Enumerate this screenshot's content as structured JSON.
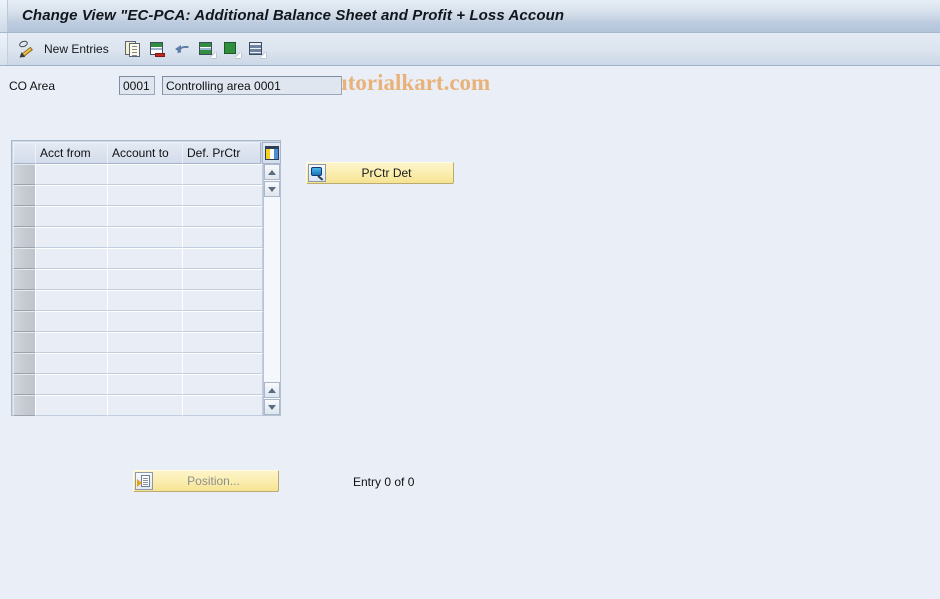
{
  "window": {
    "title": "Change View \"EC-PCA: Additional Balance Sheet and Profit + Loss Accoun"
  },
  "watermark": {
    "text": "www.tutorialkart.com",
    "color": "#e8b27a"
  },
  "toolbar": {
    "pencil_icon": "pencil-icon",
    "new_entries_label": "New Entries",
    "icons": [
      {
        "name": "copy-as-icon"
      },
      {
        "name": "delete-icon"
      },
      {
        "name": "undo-icon"
      },
      {
        "name": "select-all-icon"
      },
      {
        "name": "deselect-all-icon"
      },
      {
        "name": "select-block-icon"
      }
    ]
  },
  "co_area": {
    "label": "CO Area",
    "code_value": "0001",
    "code_placeholder": "",
    "description_value": "Controlling area 0001",
    "description_placeholder": ""
  },
  "table": {
    "columns": [
      "Acct from",
      "Account to",
      "Def. PrCtr"
    ],
    "config_icon": "table-settings-icon",
    "rows": [
      {
        "acct_from": "",
        "account_to": "",
        "def_prctr": ""
      },
      {
        "acct_from": "",
        "account_to": "",
        "def_prctr": ""
      },
      {
        "acct_from": "",
        "account_to": "",
        "def_prctr": ""
      },
      {
        "acct_from": "",
        "account_to": "",
        "def_prctr": ""
      },
      {
        "acct_from": "",
        "account_to": "",
        "def_prctr": ""
      },
      {
        "acct_from": "",
        "account_to": "",
        "def_prctr": ""
      },
      {
        "acct_from": "",
        "account_to": "",
        "def_prctr": ""
      },
      {
        "acct_from": "",
        "account_to": "",
        "def_prctr": ""
      },
      {
        "acct_from": "",
        "account_to": "",
        "def_prctr": ""
      },
      {
        "acct_from": "",
        "account_to": "",
        "def_prctr": ""
      },
      {
        "acct_from": "",
        "account_to": "",
        "def_prctr": ""
      },
      {
        "acct_from": "",
        "account_to": "",
        "def_prctr": ""
      }
    ],
    "scrollbar": {
      "up_top": "scroll-up-icon",
      "down_top": "scroll-down-icon",
      "up_bottom": "scroll-page-up-icon",
      "down_bottom": "scroll-page-down-icon"
    }
  },
  "actions": {
    "prctr_det_label": "PrCtr Det",
    "prctr_det_icon": "magnifier-icon",
    "position_label": "Position...",
    "position_icon": "position-goto-icon",
    "position_enabled": false
  },
  "status": {
    "entry_count_text": "Entry 0 of 0"
  }
}
